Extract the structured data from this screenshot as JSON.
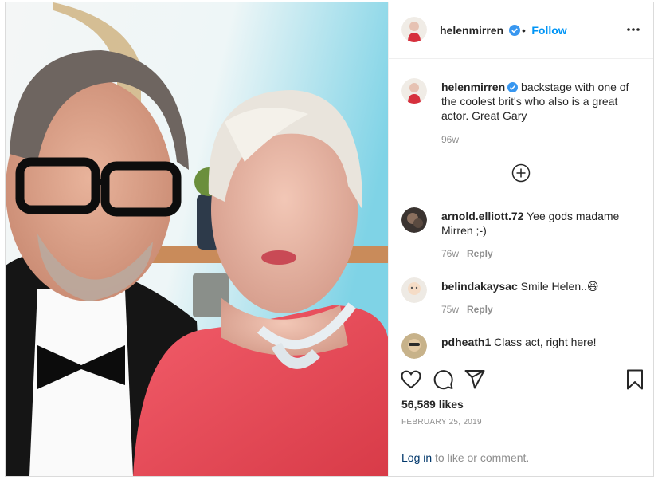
{
  "post": {
    "username": "helenmirren",
    "follow_label": "Follow",
    "separator": "•"
  },
  "caption": {
    "username": "helenmirren",
    "text": "backstage with one of the coolest brit's who also is a great actor. Great Gary",
    "age": "96w"
  },
  "comments": [
    {
      "username": "arnold.elliott.72",
      "text": "Yee gods madame Mirren ;-)",
      "age": "76w",
      "reply_label": "Reply"
    },
    {
      "username": "belindakaysac",
      "text": "Smile Helen..",
      "emoji": "😆",
      "age": "75w",
      "reply_label": "Reply"
    },
    {
      "username": "pdheath1",
      "text": "Class act, right here!"
    }
  ],
  "stats": {
    "likes": "56,589 likes",
    "date": "FEBRUARY 25, 2019"
  },
  "login": {
    "link": "Log in",
    "rest": " to like or comment."
  },
  "colors": {
    "link_blue": "#0095f6",
    "verified_blue": "#3897f0",
    "muted": "#8e8e8e",
    "text": "#262626"
  },
  "icons": [
    "verified-badge-icon",
    "more-options-icon",
    "load-more-icon",
    "heart-icon",
    "comment-icon",
    "share-icon",
    "bookmark-icon"
  ]
}
